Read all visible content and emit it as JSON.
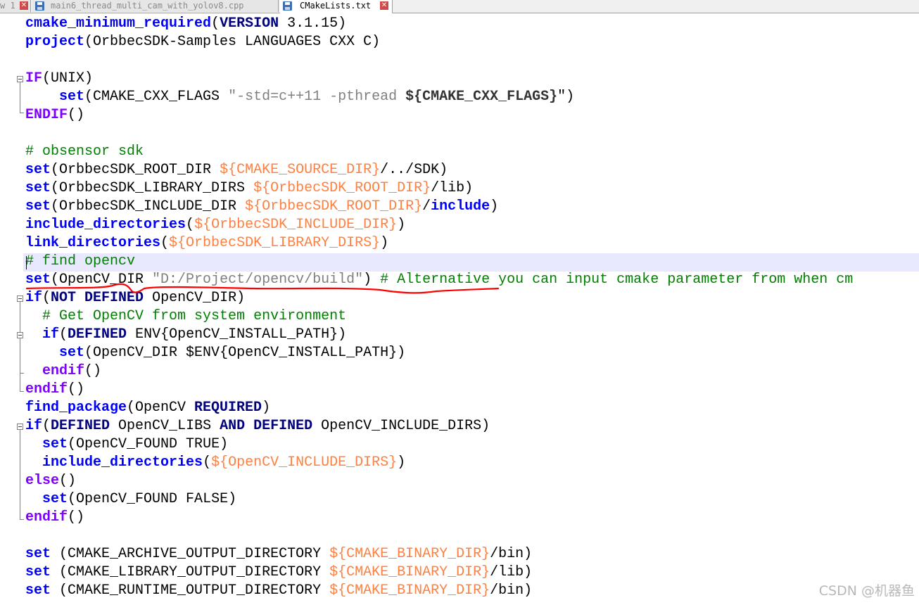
{
  "tabs": [
    {
      "label": "w 1"
    },
    {
      "label": "main6_thread_multi_cam_with_yolov8.cpp"
    },
    {
      "label": "CMakeLists.txt"
    }
  ],
  "code": {
    "l1": [
      "cmake_minimum_required",
      "(",
      "VERSION",
      " 3.1.15)"
    ],
    "l2": [
      "project",
      "(OrbbecSDK-Samples LANGUAGES CXX C)"
    ],
    "l4": [
      "IF",
      "(UNIX)"
    ],
    "l5": [
      "    ",
      "set",
      "(CMAKE_CXX_FLAGS ",
      "\"-std=c++11 -pthread ",
      "${CMAKE_CXX_FLAGS}",
      "\")"
    ],
    "l6": [
      "ENDIF",
      "()"
    ],
    "l8": [
      "# obsensor sdk"
    ],
    "l9": [
      "set",
      "(OrbbecSDK_ROOT_DIR ",
      "${CMAKE_SOURCE_DIR}",
      "/../SDK)"
    ],
    "l10": [
      "set",
      "(OrbbecSDK_LIBRARY_DIRS ",
      "${OrbbecSDK_ROOT_DIR}",
      "/lib)"
    ],
    "l11": [
      "set",
      "(OrbbecSDK_INCLUDE_DIR ",
      "${OrbbecSDK_ROOT_DIR}",
      "/",
      "include",
      ")"
    ],
    "l12": [
      "include_directories",
      "(",
      "${OrbbecSDK_INCLUDE_DIR}",
      ")"
    ],
    "l13": [
      "link_directories",
      "(",
      "${OrbbecSDK_LIBRARY_DIRS}",
      ")"
    ],
    "l14": [
      "# find opencv"
    ],
    "l15": [
      "set",
      "(OpenCV_DIR ",
      "\"D:/Project/opencv/build\"",
      ") ",
      "# Alternative you can input cmake parameter from when cm"
    ],
    "l16": [
      "if",
      "(",
      "NOT DEFINED",
      " OpenCV_DIR)"
    ],
    "l17": [
      "  ",
      "# Get OpenCV from system environment"
    ],
    "l18": [
      "  ",
      "if",
      "(",
      "DEFINED",
      " ENV{OpenCV_INSTALL_PATH})"
    ],
    "l19": [
      "    ",
      "set",
      "(OpenCV_DIR $ENV{OpenCV_INSTALL_PATH})"
    ],
    "l20": [
      "  ",
      "endif",
      "()"
    ],
    "l21": [
      "endif",
      "()"
    ],
    "l22": [
      "find_package",
      "(OpenCV ",
      "REQUIRED",
      ")"
    ],
    "l23": [
      "if",
      "(",
      "DEFINED",
      " OpenCV_LIBS ",
      "AND DEFINED",
      " OpenCV_INCLUDE_DIRS)"
    ],
    "l24": [
      "  ",
      "set",
      "(OpenCV_FOUND TRUE)"
    ],
    "l25": [
      "  ",
      "include_directories",
      "(",
      "${OpenCV_INCLUDE_DIRS}",
      ")"
    ],
    "l26": [
      "else",
      "()"
    ],
    "l27": [
      "  ",
      "set",
      "(OpenCV_FOUND FALSE)"
    ],
    "l28": [
      "endif",
      "()"
    ],
    "l30": [
      "set",
      " (CMAKE_ARCHIVE_OUTPUT_DIRECTORY ",
      "${CMAKE_BINARY_DIR}",
      "/bin)"
    ],
    "l31": [
      "set",
      " (CMAKE_LIBRARY_OUTPUT_DIRECTORY ",
      "${CMAKE_BINARY_DIR}",
      "/lib)"
    ],
    "l32": [
      "set",
      " (CMAKE_RUNTIME_OUTPUT_DIRECTORY ",
      "${CMAKE_BINARY_DIR}",
      "/bin)"
    ]
  },
  "watermark": "CSDN @机器鱼",
  "colors": {
    "keyword": "#0000ff",
    "control": "#8000ff",
    "comment": "#008000",
    "string": "#808080",
    "variable": "#ff8040",
    "annotation": "#ff0000",
    "current_line": "#e8e8ff"
  }
}
